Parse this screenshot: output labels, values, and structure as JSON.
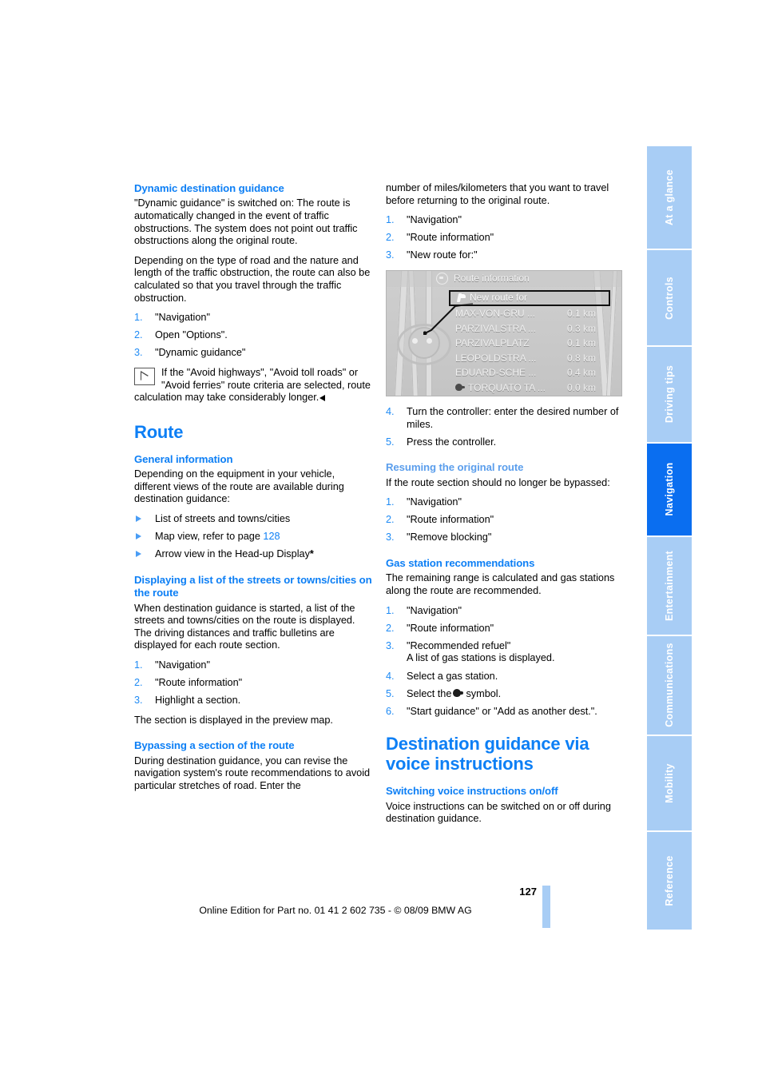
{
  "page": {
    "number": "127",
    "imprint": "Online Edition for Part no. 01 41 2 602 735 - © 08/09 BMW AG",
    "accent_blue": "#0d7ff5",
    "accent_blue_light": "#5b9eec",
    "tab_inactive_bg": "#a8cdf5",
    "tab_active_bg": "#0a6ef0"
  },
  "sidebar": {
    "tabs": [
      {
        "label": "At a glance",
        "active": false
      },
      {
        "label": "Controls",
        "active": false
      },
      {
        "label": "Driving tips",
        "active": false
      },
      {
        "label": "Navigation",
        "active": true
      },
      {
        "label": "Entertainment",
        "active": false
      },
      {
        "label": "Communications",
        "active": false
      },
      {
        "label": "Mobility",
        "active": false
      },
      {
        "label": "Reference",
        "active": false
      }
    ]
  },
  "left_column": {
    "dynamic": {
      "heading": "Dynamic destination guidance",
      "para1": "\"Dynamic guidance\" is switched on: The route is automatically changed in the event of traffic obstructions. The system does not point out traffic obstructions along the original route.",
      "para2": "Depending on the type of road and the nature and length of the traffic obstruction, the route can also be calculated so that you travel through the traffic obstruction.",
      "steps": [
        {
          "num": "1.",
          "text": "\"Navigation\""
        },
        {
          "num": "2.",
          "text": "Open \"Options\"."
        },
        {
          "num": "3.",
          "text": "\"Dynamic guidance\""
        }
      ],
      "note": "If the \"Avoid highways\", \"Avoid toll roads\" or \"Avoid ferries\" route criteria are selected, route calculation may take considerably longer."
    },
    "route": {
      "chapter_heading": "Route",
      "general": {
        "heading": "General information",
        "para": "Depending on the equipment in your vehicle, different views of the route are available during destination guidance:",
        "bullets": [
          {
            "text": "List of streets and towns/cities",
            "link": "",
            "suffix": ""
          },
          {
            "text": "Map view, refer to page ",
            "link": "128",
            "suffix": ""
          },
          {
            "text": "Arrow view in the Head-up Display",
            "link": "",
            "suffix": "*"
          }
        ]
      },
      "displaying": {
        "heading": "Displaying a list of the streets or towns/cities on the route",
        "para": "When destination guidance is started, a list of the streets and towns/cities on the route is displayed. The driving distances and traffic bulletins are displayed for each route section.",
        "steps": [
          {
            "num": "1.",
            "text": "\"Navigation\""
          },
          {
            "num": "2.",
            "text": "\"Route information\""
          },
          {
            "num": "3.",
            "text": "Highlight a section."
          }
        ],
        "after": "The section is displayed in the preview map."
      },
      "bypassing": {
        "heading": "Bypassing a section of the route",
        "para": "During destination guidance, you can revise the navigation system's route recommendations to avoid particular stretches of road. Enter the"
      }
    }
  },
  "right_column": {
    "bypassing_cont": {
      "para": "number of miles/kilometers that you want to travel before returning to the original route.",
      "steps": [
        {
          "num": "1.",
          "text": "\"Navigation\""
        },
        {
          "num": "2.",
          "text": "\"Route information\""
        },
        {
          "num": "3.",
          "text": "\"New route for:\""
        }
      ],
      "steps_after_image": [
        {
          "num": "4.",
          "text": "Turn the controller: enter the desired number of miles."
        },
        {
          "num": "5.",
          "text": "Press the controller."
        }
      ]
    },
    "nav_screenshot": {
      "header_title": "Route information",
      "header_icon": "disc-icon",
      "selected_row": {
        "label": "New route for",
        "glyph": "turn-arrow-icon"
      },
      "rows": [
        {
          "name": "MAX-VON-GRU ...",
          "distance": "0.1 km",
          "glyph": ""
        },
        {
          "name": "PARZIVALSTRA ...",
          "distance": "0.3 km",
          "glyph": ""
        },
        {
          "name": "PARZIVALPLATZ",
          "distance": "0.1 km",
          "glyph": ""
        },
        {
          "name": "LEOPOLDSTRA ...",
          "distance": "0.8 km",
          "glyph": ""
        },
        {
          "name": "EDUARD-SCHE ...",
          "distance": "0.4 km",
          "glyph": ""
        },
        {
          "name": "TORQUATO TA ...",
          "distance": "0.0 km",
          "glyph": "destination-marker-icon"
        }
      ]
    },
    "resuming": {
      "heading": "Resuming the original route",
      "para": "If the route section should no longer be bypassed:",
      "steps": [
        {
          "num": "1.",
          "text": "\"Navigation\""
        },
        {
          "num": "2.",
          "text": "\"Route information\""
        },
        {
          "num": "3.",
          "text": "\"Remove blocking\""
        }
      ]
    },
    "gas": {
      "heading": "Gas station recommendations",
      "para": "The remaining range is calculated and gas stations along the route are recommended.",
      "steps": [
        {
          "num": "1.",
          "text": "\"Navigation\"",
          "sub": ""
        },
        {
          "num": "2.",
          "text": "\"Route information\"",
          "sub": ""
        },
        {
          "num": "3.",
          "text": "\"Recommended refuel\"",
          "sub": "A list of gas stations is displayed."
        },
        {
          "num": "4.",
          "text": "Select a gas station.",
          "sub": ""
        },
        {
          "num": "5.",
          "text": "Select the",
          "sub": "",
          "sym_suffix": "symbol."
        },
        {
          "num": "6.",
          "text": "\"Start guidance\" or \"Add as another dest.\".",
          "sub": ""
        }
      ]
    },
    "voice": {
      "chapter_heading": "Destination guidance via voice instructions",
      "switching": {
        "heading": "Switching voice instructions on/off",
        "para": "Voice instructions can be switched on or off during destination guidance."
      }
    }
  }
}
